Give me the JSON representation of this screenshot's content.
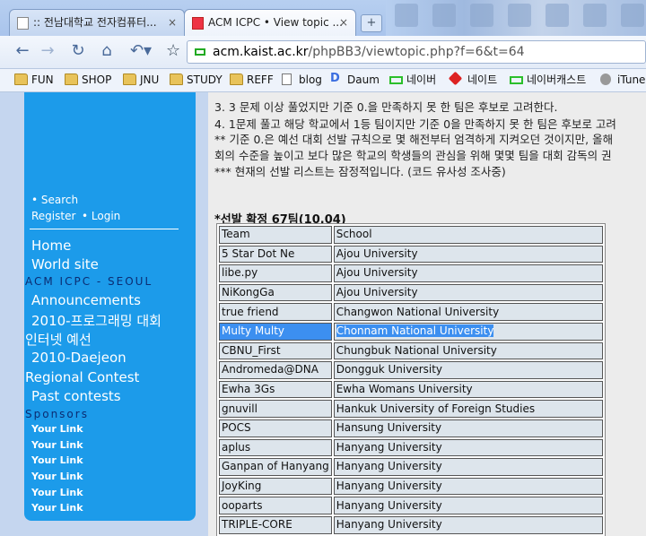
{
  "browser": {
    "tabs": [
      {
        "title": ":: 전남대학교 전자컴퓨터...",
        "close": "×"
      },
      {
        "title": "ACM ICPC • View topic ...",
        "close": "×"
      }
    ],
    "new_tab": "+",
    "url_host": "acm.kaist.ac.kr",
    "url_rest": "/phpBB3/viewtopic.php?f=6&t=64",
    "bookmarks": [
      "FUN",
      "SHOP",
      "JNU",
      "STUDY",
      "REFF",
      "blog",
      "Daum",
      "네이버",
      "네이트",
      "네이버캐스트",
      "iTune"
    ]
  },
  "sidebar": {
    "search": "• Search",
    "register": "Register",
    "login": "• Login",
    "home": "Home",
    "world_site": "World site",
    "acm_heading": "ACM ICPC - SEOUL",
    "announcements": "Announcements",
    "contest_2010_line1": "2010-프로그래밍 대회",
    "contest_2010_line2": "인터넷 예선",
    "daejeon": "2010-Daejeon",
    "regional": "Regional Contest",
    "past": "Past contests",
    "sponsors_heading": "Sponsors",
    "links": [
      "Your Link",
      "Your Link",
      "Your Link",
      "Your Link",
      "Your Link",
      "Your Link"
    ]
  },
  "content": {
    "lines": [
      "3. 3 문제 이상 풀었지만 기준 0.을 만족하지 못 한 팀은 후보로 고려한다.",
      "4. 1문제 풀고 해당 학교에서 1등 팀이지만 기준 0을 만족하지 못 한 팀은 후보로 고려",
      "** 기준 0.은 예선 대회 선발 규칙으로 몇 해전부터 엄격하게 지켜오던 것이지만, 올해",
      "회의 수준을 높이고 보다 많은 학교의 학생들의 관심을 위해 몇몇 팀을 대회 감독의 권",
      "*** 현재의 선발 리스트는 잠정적입니다. (코드 유사성 조사중)"
    ],
    "list_title": "*선발 확정 67팀(10.04)",
    "table": {
      "headers": [
        "Team",
        "School"
      ],
      "rows": [
        [
          "5 Star Dot Ne",
          "Ajou University"
        ],
        [
          "libe.py",
          "Ajou University"
        ],
        [
          "NiKongGa",
          "Ajou University"
        ],
        [
          "true friend",
          "Changwon National University"
        ],
        [
          "Multy Multy",
          "Chonnam National University"
        ],
        [
          "CBNU_First",
          "Chungbuk National University"
        ],
        [
          "Andromeda@DNA",
          "Dongguk University"
        ],
        [
          "Ewha 3Gs",
          "Ewha Womans University"
        ],
        [
          "gnuvill",
          "Hankuk University of Foreign Studies"
        ],
        [
          "POCS",
          "Hansung University"
        ],
        [
          "aplus",
          "Hanyang University"
        ],
        [
          "Ganpan of Hanyang",
          "Hanyang University"
        ],
        [
          "JoyKing",
          "Hanyang University"
        ],
        [
          "ooparts",
          "Hanyang University"
        ],
        [
          "TRIPLE-CORE",
          "Hanyang University"
        ]
      ]
    }
  }
}
